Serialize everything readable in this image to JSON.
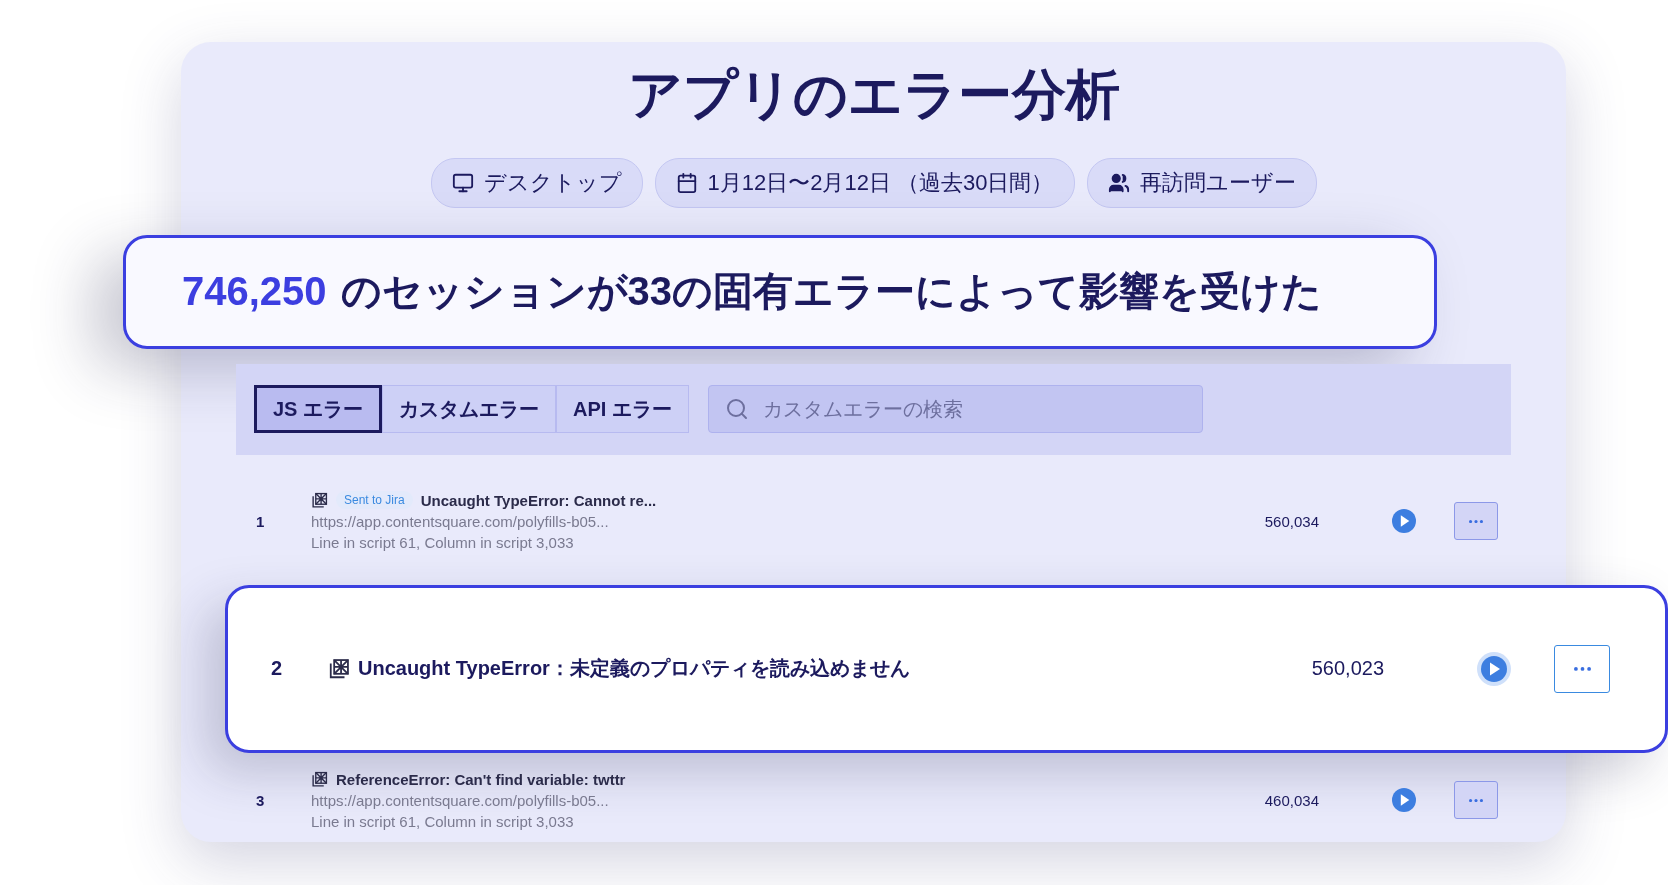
{
  "title": "アプリのエラー分析",
  "filters": [
    {
      "kind": "device",
      "label": "デスクトップ"
    },
    {
      "kind": "date",
      "label": "1月12日〜2月12日 （過去30日間）"
    },
    {
      "kind": "users",
      "label": "再訪問ユーザー"
    }
  ],
  "summary": {
    "count": "746,250",
    "text": "のセッションが33の固有エラーによって影響を受けた"
  },
  "tabs": [
    {
      "label": "JS エラー",
      "selected": true
    },
    {
      "label": "カスタムエラー",
      "selected": false
    },
    {
      "label": "API エラー",
      "selected": false
    }
  ],
  "search": {
    "placeholder": "カスタムエラーの検索"
  },
  "errors": [
    {
      "rank": "1",
      "badge": "Sent to Jira",
      "message": "Uncaught TypeError: Cannot re...",
      "url": "https://app.contentsquare.com/polyfills-b05...",
      "location": "Line in script 61, Column in script 3,033",
      "count": "560,034",
      "highlighted": false
    },
    {
      "rank": "2",
      "message": "Uncaught TypeError：未定義のプロパティを読み込めません",
      "count": "560,023",
      "highlighted": true
    },
    {
      "rank": "3",
      "message": "ReferenceError: Can't find variable: twttr",
      "url": "https://app.contentsquare.com/polyfills-b05...",
      "location": "Line in script 61, Column in script 3,033",
      "count": "460,034",
      "highlighted": false
    }
  ]
}
